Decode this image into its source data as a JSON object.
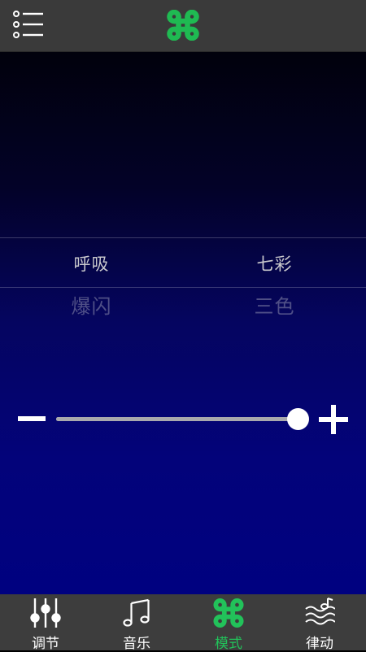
{
  "header": {
    "menu_icon": "list-menu-icon",
    "logo_icon": "command-loop-icon",
    "accent_color": "#1fba52"
  },
  "picker": {
    "left_column": {
      "selected": "呼吸",
      "next": "爆闪"
    },
    "right_column": {
      "selected": "七彩",
      "next": "三色"
    }
  },
  "slider": {
    "level_percent": 100,
    "minus_icon": "minus-icon",
    "plus_icon": "plus-icon"
  },
  "tabs": [
    {
      "label": "调节",
      "icon": "equalizer-sliders-icon",
      "active": false
    },
    {
      "label": "音乐",
      "icon": "music-note-icon",
      "active": false
    },
    {
      "label": "模式",
      "icon": "command-loop-icon",
      "active": true
    },
    {
      "label": "律动",
      "icon": "waves-note-icon",
      "active": false
    }
  ],
  "colors": {
    "active_tab": "#22c25a",
    "bar_background": "#3d3d3d"
  }
}
